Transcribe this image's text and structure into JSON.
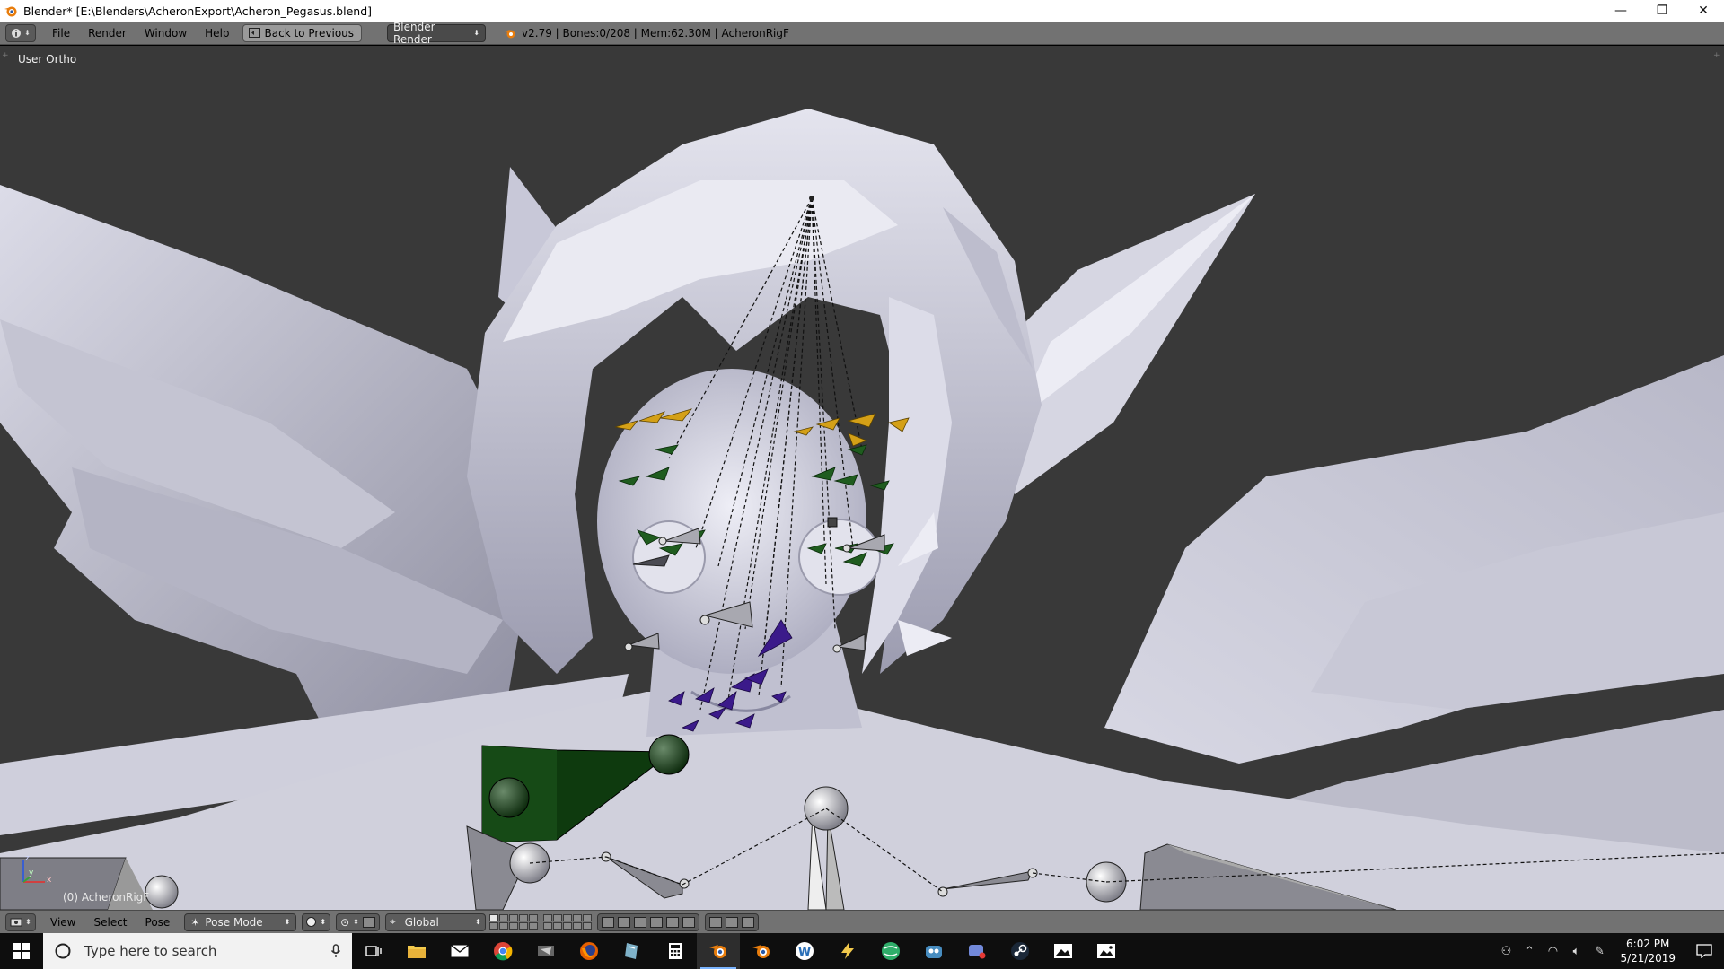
{
  "window": {
    "title": "Blender* [E:\\Blenders\\AcheronExport\\Acheron_Pegasus.blend]",
    "controls": {
      "minimize": "—",
      "restore": "❐",
      "close": "✕"
    }
  },
  "info_header": {
    "menus": [
      "File",
      "Render",
      "Window",
      "Help"
    ],
    "back_button": "Back to Previous",
    "render_engine": "Blender Render",
    "stats": "v2.79 | Bones:0/208 | Mem:62.30M | AcheronRigF"
  },
  "viewport": {
    "view_label": "User Ortho",
    "object_label": "(0) AcheronRigF",
    "axis_x": "x",
    "axis_y": "y",
    "axis_z": "z",
    "background_color": "#393939"
  },
  "view3d_header": {
    "menus": [
      "View",
      "Select",
      "Pose"
    ],
    "mode": "Pose Mode",
    "orientation": "Global"
  },
  "taskbar": {
    "search_placeholder": "Type here to search",
    "time": "6:02 PM",
    "date": "5/21/2019",
    "apps": [
      "task-view",
      "file-explorer",
      "mail",
      "chrome",
      "app-5",
      "firefox",
      "app-7",
      "calculator",
      "blender",
      "blender-2",
      "app-w",
      "app-11",
      "app-12",
      "app-13",
      "app-14",
      "steam",
      "app-16",
      "photos"
    ]
  },
  "colors": {
    "titlebar_bg": "#ffffff",
    "header_bg": "#727272",
    "taskbar_bg": "#0e0e0e",
    "bone_yellow": "#d4a017",
    "bone_green": "#1f5c1f",
    "bone_purple": "#3b1a8a",
    "model_color": "#c8c8d8"
  }
}
